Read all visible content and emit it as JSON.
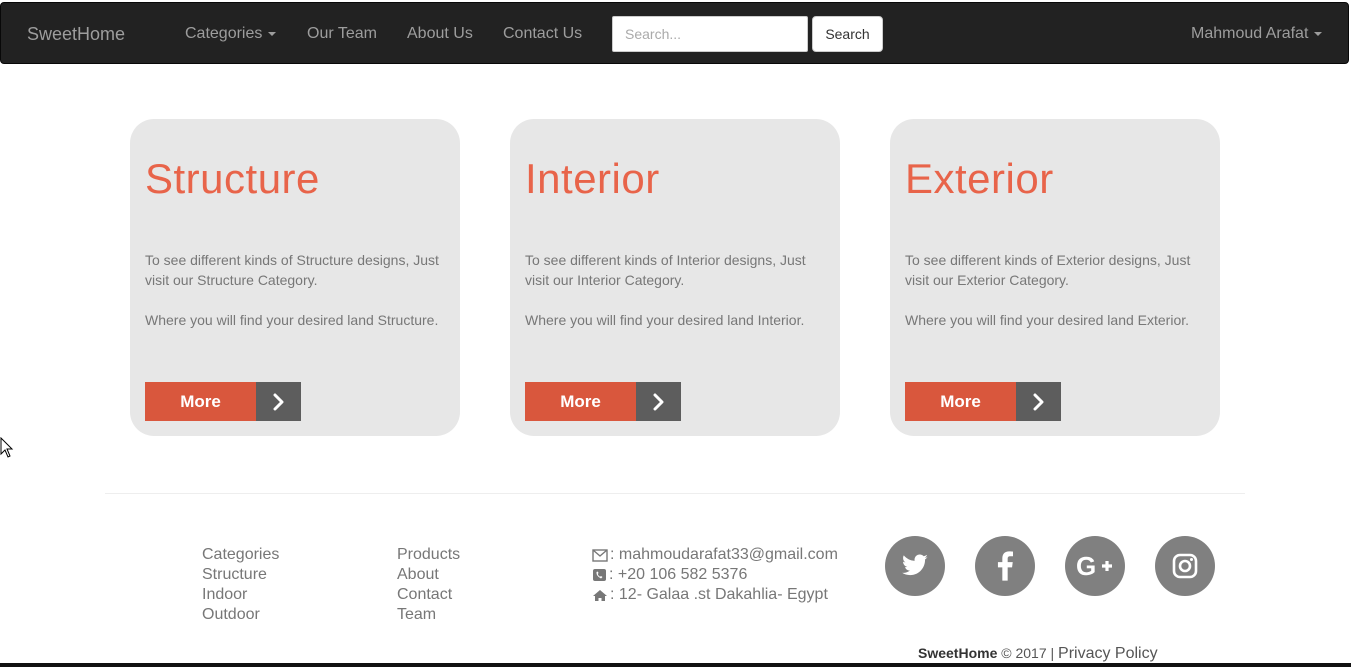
{
  "navbar": {
    "brand": "SweetHome",
    "categories": "Categories",
    "our_team": "Our Team",
    "about_us": "About Us",
    "contact_us": "Contact Us",
    "search_placeholder": "Search...",
    "search_button": "Search",
    "user": "Mahmoud Arafat"
  },
  "cards": [
    {
      "title": "Structure",
      "desc": "To see different kinds of Structure designs, Just visit our Structure Category.",
      "desc2": "Where you will find your desired land Structure.",
      "button": "More"
    },
    {
      "title": "Interior",
      "desc": "To see different kinds of Interior designs, Just visit our Interior Category.",
      "desc2": "Where you will find your desired land Interior.",
      "button": "More"
    },
    {
      "title": "Exterior",
      "desc": "To see different kinds of Exterior designs, Just visit our Exterior Category.",
      "desc2": "Where you will find your desired land Exterior.",
      "button": "More"
    }
  ],
  "footer": {
    "col1": [
      "Categories",
      "Structure",
      "Indoor",
      "Outdoor"
    ],
    "col2": [
      "Products",
      "About",
      "Contact",
      "Team"
    ],
    "contact": {
      "email": ": mahmoudarafat33@gmail.com",
      "phone": ": +20 106 582 5376",
      "address": ": 12- Galaa .st Dakahlia- Egypt"
    },
    "social": [
      "twitter-icon",
      "facebook-icon",
      "google-plus-icon",
      "instagram-icon"
    ],
    "copyright_brand": "SweetHome",
    "copyright_text": " © 2017 | ",
    "privacy": "Privacy Policy"
  },
  "colors": {
    "navbar_bg": "#222222",
    "accent": "#e8644a",
    "button_orange": "#d9573d",
    "button_gray": "#5d5d5d",
    "card_bg": "#e7e7e7",
    "social_bg": "#808080"
  }
}
